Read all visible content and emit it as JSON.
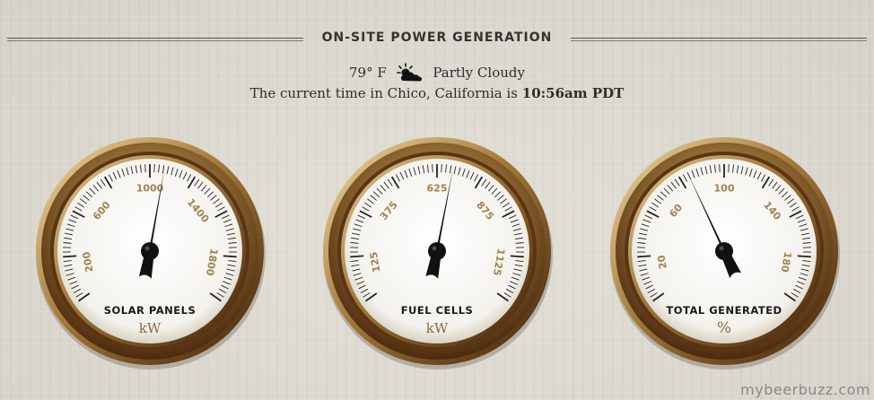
{
  "header": {
    "title": "ON-SITE POWER GENERATION"
  },
  "weather": {
    "temperature": "79° F",
    "condition": "Partly Cloudy",
    "icon": "partly-cloudy-icon"
  },
  "time": {
    "prefix": "The current time in Chico, California is",
    "value": "10:56am PDT"
  },
  "gauges": [
    {
      "id": "solar",
      "label": "SOLAR PANELS",
      "unit": "kW",
      "ticks": [
        "200",
        "600",
        "1000",
        "1400",
        "1800"
      ],
      "value": 1080,
      "min": 0,
      "max": 2000
    },
    {
      "id": "fuel",
      "label": "FUEL CELLS",
      "unit": "kW",
      "ticks": [
        "125",
        "375",
        "625",
        "875",
        "1125"
      ],
      "value": 680,
      "min": 0,
      "max": 1250
    },
    {
      "id": "total",
      "label": "TOTAL GENERATED",
      "unit": "%",
      "ticks": [
        "20",
        "60",
        "100",
        "140",
        "180"
      ],
      "value": 80,
      "min": 0,
      "max": 200
    }
  ],
  "watermark": "mybeerbuzz.com",
  "colors": {
    "tick_label": "#a08350",
    "unit": "#8a6a3a",
    "bezel_dark": "#5a3514",
    "bezel_light": "#c9a96a",
    "needle": "#111111"
  }
}
